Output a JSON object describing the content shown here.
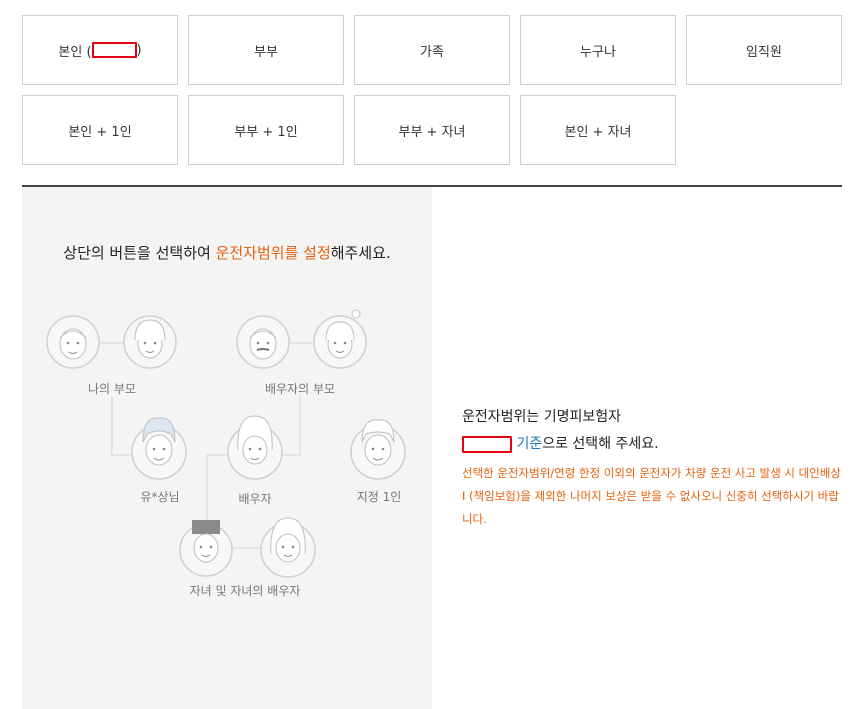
{
  "options_row1": [
    {
      "label_prefix": "본인 (",
      "label_suffix": ")"
    },
    {
      "label": "부부"
    },
    {
      "label": "가족"
    },
    {
      "label": "누구나"
    },
    {
      "label": "임직원"
    }
  ],
  "options_row2": [
    {
      "label": "본인 + 1인"
    },
    {
      "label": "부부 + 1인"
    },
    {
      "label": "부부 + 자녀"
    },
    {
      "label": "본인 + 자녀"
    }
  ],
  "instruction": {
    "part1": "상단의 버튼을 선택하여 ",
    "highlight": "운전자범위를 설정",
    "part2": "해주세요."
  },
  "family": {
    "my_parents": "나의 부모",
    "spouse_parents": "배우자의 부모",
    "insured": "유*상님",
    "spouse": "배우자",
    "designated": "지정 1인",
    "children": "자녀 및 자녀의 배우자"
  },
  "info": {
    "line1": "운전자범위는 기명피보험자",
    "line2_blue": "기준",
    "line2_rest": "으로 선택해 주세요.",
    "warning": "선택한 운전자범위/연령 한정 이외의 운전자가 차량 운전 사고 발생 시 대인배상 I (책임보험)을 제외한 나머지 보상은 받을 수 없사오니 신중히 선택하시기 바랍니다."
  },
  "colors": {
    "accent_orange": "#e8600c",
    "link_blue": "#1a7bb8",
    "redaction_red": "#e60012",
    "panel_gray": "#f4f4f4"
  }
}
